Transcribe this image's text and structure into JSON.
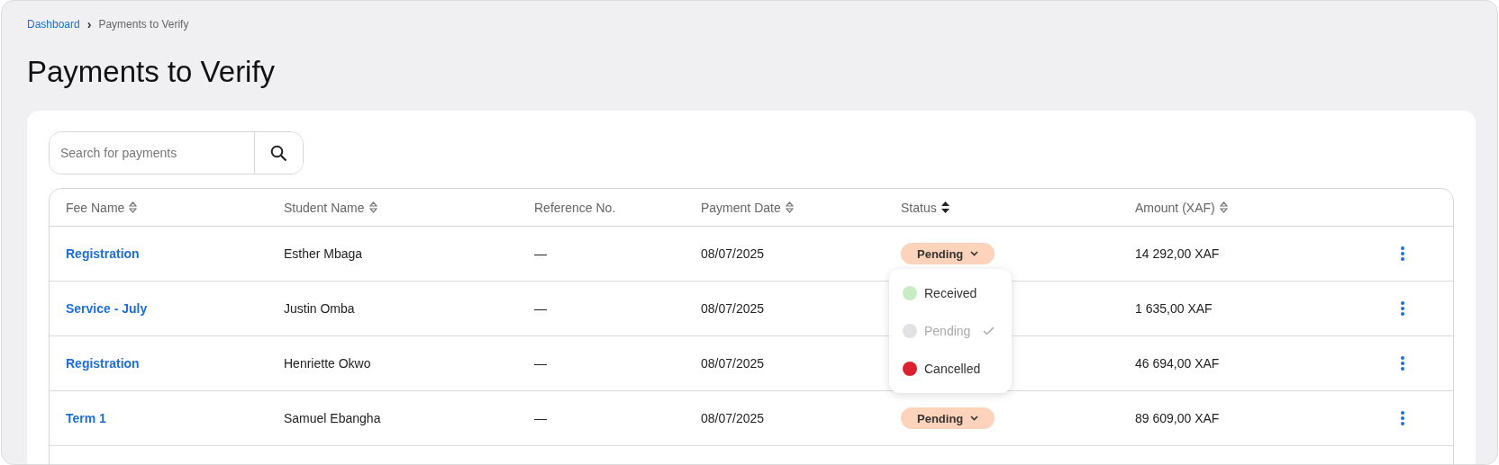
{
  "breadcrumb": {
    "link": "Dashboard",
    "separator": "›",
    "current": "Payments to Verify"
  },
  "title": "Payments to Verify",
  "search": {
    "placeholder": "Search for payments"
  },
  "table": {
    "columns": [
      {
        "label": "Fee Name",
        "sortable": true,
        "sorted": false
      },
      {
        "label": "Student Name",
        "sortable": true,
        "sorted": false
      },
      {
        "label": "Reference No.",
        "sortable": false
      },
      {
        "label": "Payment Date",
        "sortable": true,
        "sorted": false
      },
      {
        "label": "Status",
        "sortable": true,
        "sorted": true
      },
      {
        "label": "Amount (XAF)",
        "sortable": true,
        "sorted": false
      }
    ],
    "rows": [
      {
        "fee": "Registration",
        "student": "Esther Mbaga",
        "reference": "—",
        "date": "08/07/2025",
        "status": "Pending",
        "amount": "14 292,00 XAF"
      },
      {
        "fee": "Service - July",
        "student": "Justin Omba",
        "reference": "—",
        "date": "08/07/2025",
        "amount": "1 635,00 XAF"
      },
      {
        "fee": "Registration",
        "student": "Henriette Okwo",
        "reference": "—",
        "date": "08/07/2025",
        "amount": "46 694,00 XAF"
      },
      {
        "fee": "Term 1",
        "student": "Samuel Ebangha",
        "reference": "—",
        "date": "08/07/2025",
        "status": "Pending",
        "amount": "89 609,00 XAF"
      }
    ]
  },
  "status_menu": {
    "options": [
      {
        "label": "Received",
        "color": "#c8ecc4",
        "selected": false
      },
      {
        "label": "Pending",
        "color": "#e2e2e4",
        "selected": true
      },
      {
        "label": "Cancelled",
        "color": "#d9222d",
        "selected": false
      }
    ]
  }
}
